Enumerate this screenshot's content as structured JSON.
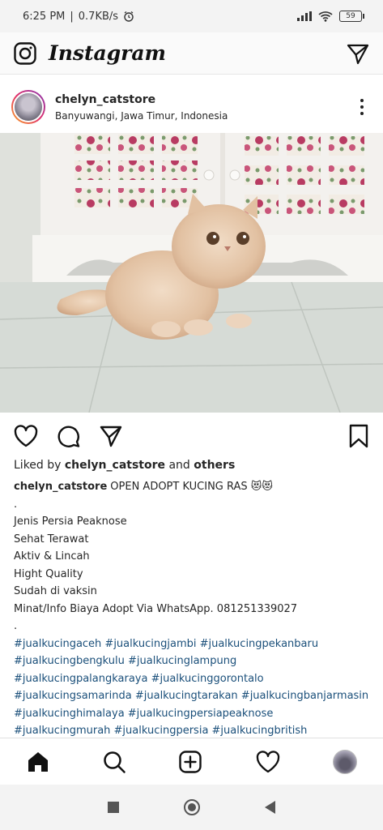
{
  "status_bar": {
    "time": "6:25 PM",
    "separator": "|",
    "speed": "0.7KB/s",
    "battery": "59"
  },
  "header": {
    "app_name": "Instagram",
    "icons": [
      "camera-icon",
      "direct-message-icon"
    ]
  },
  "post": {
    "username": "chelyn_catstore",
    "location": "Banyuwangi, Jawa Timur, Indonesia",
    "likes_prefix": "Liked by ",
    "likes_user": "chelyn_catstore",
    "likes_and": " and ",
    "likes_others": "others",
    "caption_user": "chelyn_catstore",
    "caption_title": "OPEN ADOPT KUCING RAS 😻😻",
    "caption_lines": [
      ".",
      "Jenis Persia Peaknose",
      "Sehat Terawat",
      "Aktiv & Lincah",
      "Hight Quality",
      "Sudah di vaksin",
      "Minat/Info Biaya Adopt Via WhatsApp. 081251339027",
      "."
    ],
    "hashtag_lines": [
      "#jualkucingaceh #jualkucingjambi #jualkucingpekanbaru",
      "#jualkucingbengkulu #jualkucinglampung",
      "#jualkucingpalangkaraya #jualkucinggorontalo",
      "#jualkucingsamarinda #jualkucingtarakan #jualkucingbanjarmasin",
      "#jualkucinghimalaya #jualkucingpersiapeaknose",
      "#jualkucingmurah #jualkucingpersia #jualkucingbritish"
    ]
  },
  "bottom_nav": [
    "home-icon",
    "search-icon",
    "add-post-icon",
    "activity-heart-icon",
    "profile-avatar"
  ],
  "colors": {
    "hashtag": "#1a4f7a",
    "text": "#262626"
  }
}
